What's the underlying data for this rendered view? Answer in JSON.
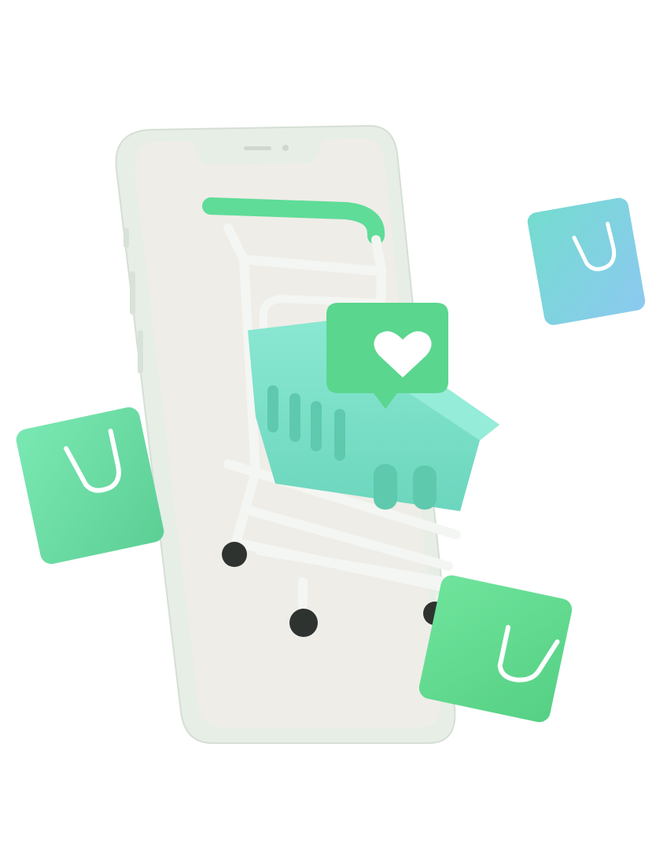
{
  "illustration": {
    "subject": "shopping-cart-on-smartphone",
    "colors": {
      "background": "#ffffff",
      "phone_frame": "#e6eee6",
      "phone_screen": "#efede8",
      "cart_handle": "#5fdc98",
      "cart_frame": "#f4f6f3",
      "basket": "#7fe2c9",
      "heart_bubble": "#5bd68e",
      "heart": "#ffffff",
      "bag_left": "#6ddfa6",
      "bag_top_right": "#7fd3e6",
      "bag_bottom_right": "#5fdc8e",
      "wheels": "#2e3330"
    },
    "icons": [
      "heart-icon",
      "shopping-bag-icon",
      "shopping-cart-icon",
      "smartphone-icon"
    ]
  }
}
